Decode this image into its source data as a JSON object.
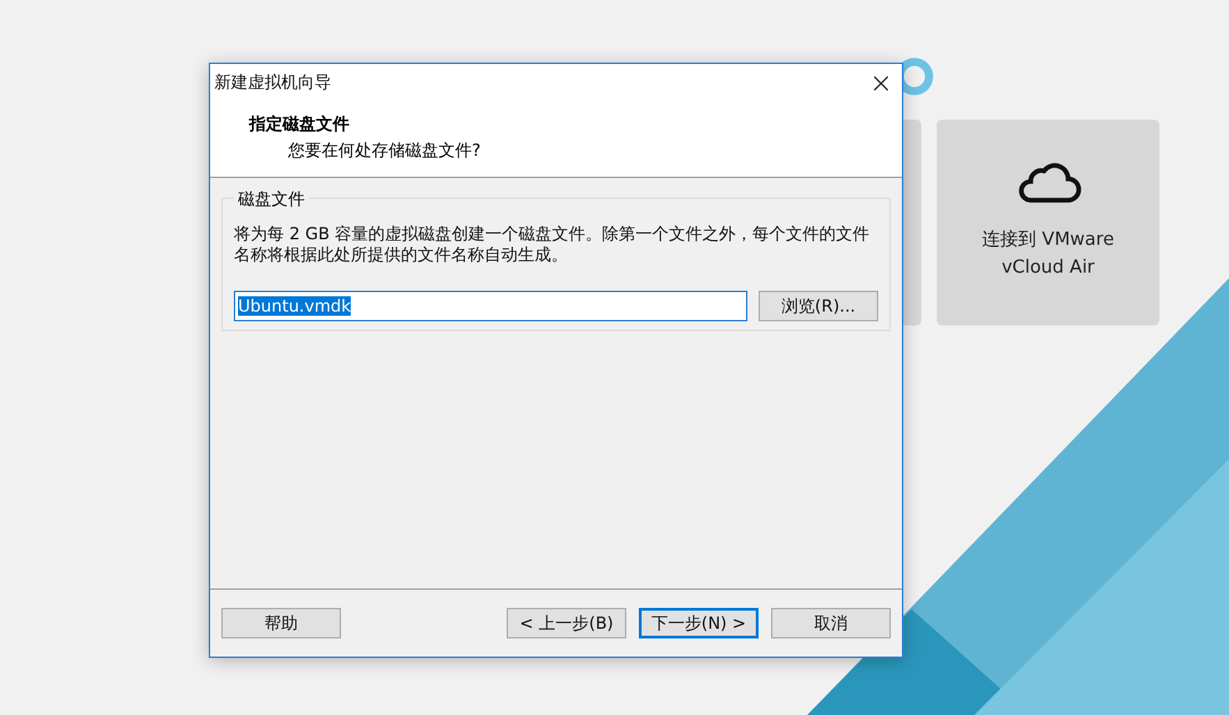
{
  "background_card": {
    "label_lines": [
      "连接到 VMware",
      "vCloud Air"
    ]
  },
  "window": {
    "title": "新建虚拟机向导"
  },
  "header": {
    "title": "指定磁盘文件",
    "subtitle": "您要在何处存储磁盘文件?"
  },
  "group": {
    "legend": "磁盘文件",
    "description_lines": [
      "将为每 2 GB 容量的虚拟磁盘创建一个磁盘文件。除第一个文件之外，每个文件的文件",
      "名称将根据此处所提供的文件名称自动生成。"
    ],
    "file_field": {
      "value": "Ubuntu.vmdk",
      "text_selected": true
    },
    "browse_button": "浏览(R)..."
  },
  "buttons": [
    {
      "label": "帮助",
      "default": false,
      "kind": "left"
    },
    {
      "label": "< 上一步(B)",
      "default": false,
      "kind": "right"
    },
    {
      "label": "下一步(N) >",
      "default": true,
      "kind": "right"
    },
    {
      "label": "取消",
      "default": false,
      "kind": "right"
    }
  ]
}
